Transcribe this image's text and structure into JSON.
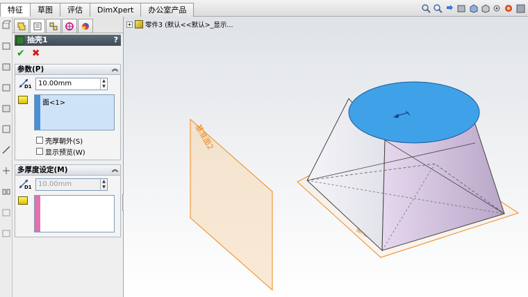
{
  "tabs": [
    {
      "label": "特征",
      "active": true
    },
    {
      "label": "草图",
      "active": false
    },
    {
      "label": "评估",
      "active": false
    },
    {
      "label": "DimXpert",
      "active": false
    },
    {
      "label": "办公室产品",
      "active": false
    }
  ],
  "feature": {
    "title": "抽壳1",
    "help": "?",
    "ok_symbol": "✔",
    "cancel_symbol": "✖"
  },
  "params": {
    "header": "参数(P)",
    "thickness": "10.00mm",
    "faces_selected": "面<1>",
    "dim_tag": "D1",
    "shell_outward_label": "壳厚朝外(S)",
    "show_preview_label": "显示预览(W)"
  },
  "multi": {
    "header": "多厚度设定(M)",
    "thickness": "10.00mm",
    "dim_tag": "D1"
  },
  "tree": {
    "root_label": "零件3 (默认<<默认>_显示..."
  },
  "plane_label": "基准面2",
  "plane_label_small": "基准面",
  "colors": {
    "top_face": "#3fa2e8",
    "plane": "#f08a1c",
    "selection_stripe": "#4a8ed8",
    "multi_stripe": "#e66fb0"
  },
  "icons": [
    "feature-manager-icon",
    "property-manager-icon",
    "configuration-manager-icon",
    "dimxpert-icon",
    "display-manager-icon"
  ]
}
